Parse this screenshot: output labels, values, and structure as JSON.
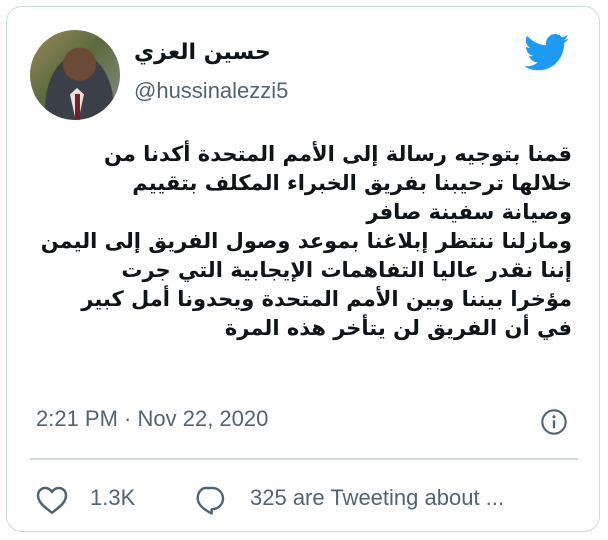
{
  "author": {
    "display_name": "حسين العزي",
    "handle": "@hussinalezzi5",
    "avatar_icon": "user-photo"
  },
  "brand": {
    "logo_icon": "twitter-bird-icon",
    "color": "#1d9bf0"
  },
  "tweet": {
    "lines": [
      "قمنا بتوجيه رسالة إلى الأمم المتحدة أكدنا من",
      "خلالها ترحيبنا بفريق الخبراء المكلف بتقييم",
      "وصيانة سفينة صافر",
      "ومازلنا ننتظر إبلاغنا بموعد وصول الفريق إلى اليمن",
      "إننا نقدر عاليا التفاهمات الإيجابية التي جرت",
      "مؤخرا بيننا وبين الأمم المتحدة ويحدونا أمل كبير",
      "في أن الفريق لن يتأخر هذه المرة"
    ],
    "timestamp": "2:21 PM · Nov 22, 2020"
  },
  "actions": {
    "like_count": "1.3K",
    "tweeting_about": "325 are Tweeting about ..."
  },
  "colors": {
    "text": "#0f1419",
    "secondary": "#536471",
    "border": "#cfd9de"
  }
}
